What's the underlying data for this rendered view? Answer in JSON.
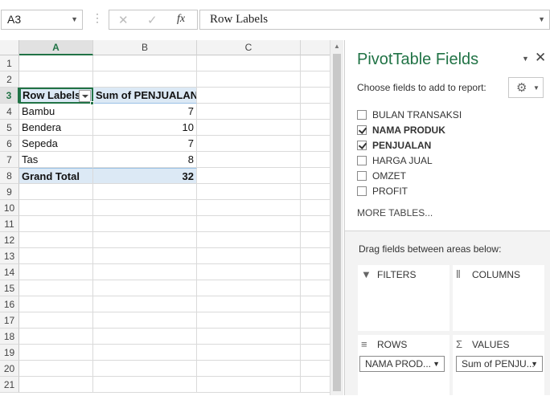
{
  "formula_bar": {
    "name_box": "A3",
    "cancel_icon": "✕",
    "enter_icon": "✓",
    "fx_label": "fx",
    "formula_text": "Row Labels"
  },
  "sheet": {
    "columns": [
      "A",
      "B",
      "C"
    ],
    "rows": [
      "1",
      "2",
      "3",
      "4",
      "5",
      "6",
      "7",
      "8",
      "9",
      "10",
      "11",
      "12",
      "13",
      "14",
      "15",
      "16",
      "17",
      "18",
      "19",
      "20",
      "21"
    ],
    "active_cell": "A3",
    "pivot": {
      "header_row_labels": "Row Labels",
      "header_sum": "Sum of PENJUALAN",
      "items": [
        {
          "label": "Bambu",
          "value": "7"
        },
        {
          "label": "Bendera",
          "value": "10"
        },
        {
          "label": "Sepeda",
          "value": "7"
        },
        {
          "label": "Tas",
          "value": "8"
        }
      ],
      "grand_total_label": "Grand Total",
      "grand_total_value": "32"
    }
  },
  "pivot_pane": {
    "title": "PivotTable Fields",
    "choose_text": "Choose fields to add to report:",
    "fields": [
      {
        "label": "BULAN TRANSAKSI",
        "checked": false
      },
      {
        "label": "NAMA PRODUK",
        "checked": true
      },
      {
        "label": "PENJUALAN",
        "checked": true
      },
      {
        "label": "HARGA JUAL",
        "checked": false
      },
      {
        "label": "OMZET",
        "checked": false
      },
      {
        "label": "PROFIT",
        "checked": false
      }
    ],
    "more_tables": "MORE TABLES...",
    "drag_text": "Drag fields between areas below:",
    "areas": {
      "filters": "FILTERS",
      "columns": "COLUMNS",
      "rows": "ROWS",
      "values": "VALUES"
    },
    "rows_field": "NAMA PROD...",
    "values_field": "Sum of PENJU..."
  },
  "colors": {
    "excel_green": "#217346",
    "pivot_header_fill": "#dce9f5"
  }
}
